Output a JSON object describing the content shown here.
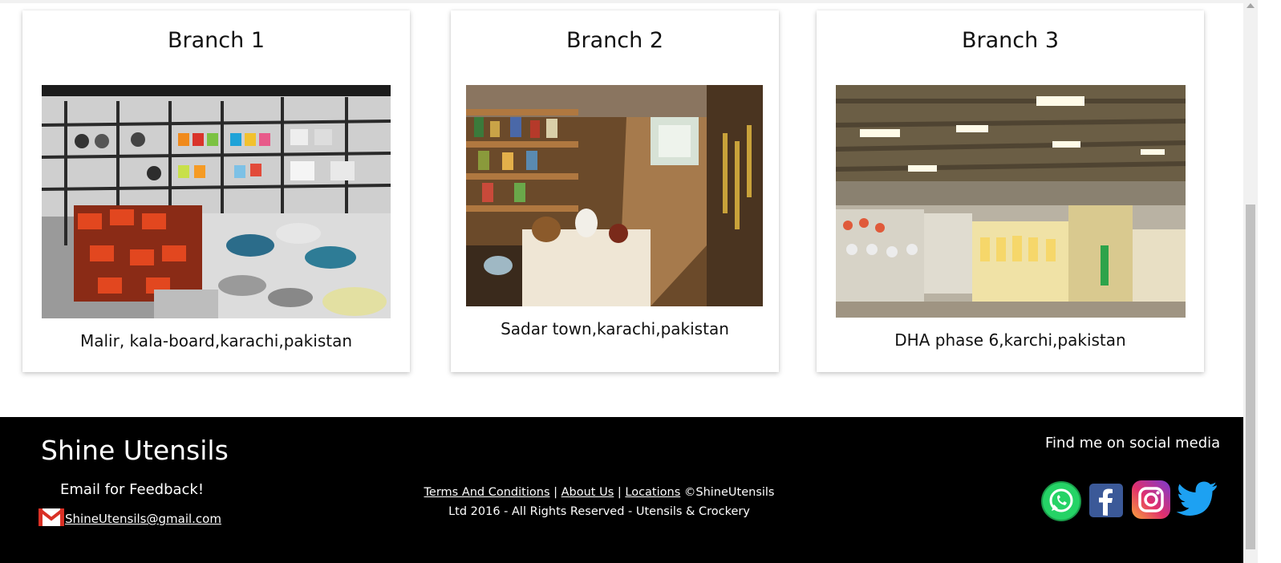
{
  "branches": [
    {
      "title": "Branch 1",
      "address": "Malir, kala-board,karachi,pakistan"
    },
    {
      "title": "Branch 2",
      "address": "Sadar town,karachi,pakistan"
    },
    {
      "title": "Branch 3",
      "address": "DHA phase 6,karchi,pakistan"
    }
  ],
  "footer": {
    "brand": "Shine Utensils",
    "feedback_label": "Email for Feedback!",
    "email": "ShineUtensils@gmail.com",
    "links": {
      "terms": "Terms And Conditions",
      "sep1": " | ",
      "about": "About Us",
      "sep2": " | ",
      "locations": "Locations",
      "copyright": " ©ShineUtensils",
      "line2": "Ltd 2016 - All Rights Reserved - Utensils & Crockery"
    },
    "social_title": "Find me on social media",
    "social_icons": [
      "whatsapp-icon",
      "facebook-icon",
      "instagram-icon",
      "twitter-icon"
    ]
  },
  "colors": {
    "footer_bg": "#000000",
    "whatsapp": "#25D366",
    "facebook": "#3b5998",
    "twitter": "#1DA1F2",
    "gmail": "#D93025"
  }
}
